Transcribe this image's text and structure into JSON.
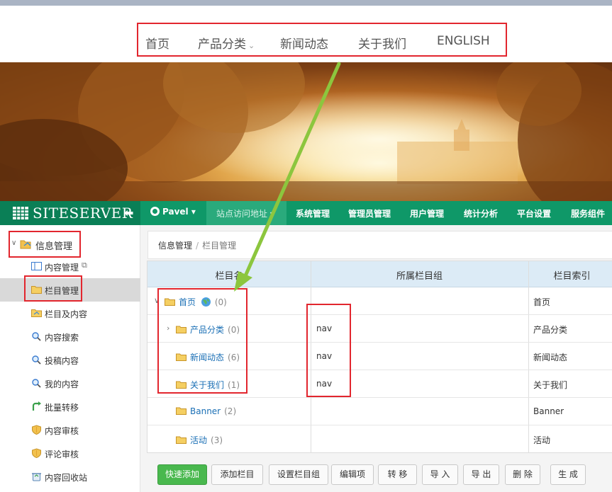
{
  "site_nav": {
    "items": [
      {
        "label": "首页"
      },
      {
        "label": "产品分类",
        "has_dropdown": true
      },
      {
        "label": "新闻动态"
      },
      {
        "label": "关于我们"
      },
      {
        "label": "ENGLISH"
      }
    ]
  },
  "admin": {
    "logo_text": "SITESERVER",
    "user_name": "Pavel",
    "site_url_label": "站点访问地址",
    "top_menu": [
      "系统管理",
      "管理员管理",
      "用户管理",
      "统计分析",
      "平台设置",
      "服务组件"
    ]
  },
  "sidebar": {
    "root_label": "信息管理",
    "items": [
      {
        "label": "内容管理",
        "icon": "content-icon"
      },
      {
        "label": "栏目管理",
        "icon": "folder-icon",
        "active": true
      },
      {
        "label": "栏目及内容",
        "icon": "folder-icon"
      },
      {
        "label": "内容搜索",
        "icon": "search-icon"
      },
      {
        "label": "投稿内容",
        "icon": "search-icon"
      },
      {
        "label": "我的内容",
        "icon": "search-icon"
      },
      {
        "label": "批量转移",
        "icon": "arrow-icon"
      },
      {
        "label": "内容审核",
        "icon": "shield-icon"
      },
      {
        "label": "评论审核",
        "icon": "shield-icon"
      },
      {
        "label": "内容回收站",
        "icon": "recycle-icon"
      }
    ]
  },
  "breadcrumb": {
    "root": "信息管理",
    "separator": "/",
    "current": "栏目管理"
  },
  "table": {
    "headers": [
      "栏目名",
      "所属栏目组",
      "栏目索引"
    ],
    "rows": [
      {
        "name": "首页",
        "count": "(0)",
        "group": "",
        "index": "首页"
      },
      {
        "name": "产品分类",
        "count": "(0)",
        "group": "nav",
        "index": "产品分类"
      },
      {
        "name": "新闻动态",
        "count": "(6)",
        "group": "nav",
        "index": "新闻动态"
      },
      {
        "name": "关于我们",
        "count": "(1)",
        "group": "nav",
        "index": "关于我们"
      },
      {
        "name": "Banner",
        "count": "(2)",
        "group": "",
        "index": "Banner"
      },
      {
        "name": "活动",
        "count": "(3)",
        "group": "",
        "index": "活动"
      }
    ]
  },
  "buttons": [
    "快速添加",
    "添加栏目",
    "设置栏目组",
    "编辑项",
    "转 移",
    "导 入",
    "导 出",
    "删 除",
    "生 成"
  ],
  "colors": {
    "admin_green": "#0f9868",
    "highlight_red": "#e2262e",
    "annotation_arrow": "#8cc63e",
    "link_blue": "#1a6fb5"
  }
}
